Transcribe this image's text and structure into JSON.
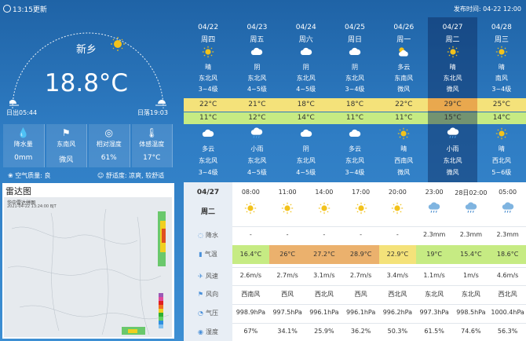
{
  "header": {
    "update_label": "13:15更新",
    "publish_label": "发布时间: 04-22 12:00"
  },
  "current": {
    "city": "新乡",
    "temperature": "18.8°C",
    "sunrise": "日出05:44",
    "sunset": "日落19:03",
    "stats": [
      {
        "label": "降水量",
        "value": "0mm",
        "icon": "raindrop-icon"
      },
      {
        "label": "东南风",
        "value": "微风",
        "icon": "wind-icon"
      },
      {
        "label": "相对湿度",
        "value": "61%",
        "icon": "humidity-icon"
      },
      {
        "label": "体感温度",
        "value": "17°C",
        "icon": "thermometer-icon"
      }
    ],
    "air_quality": "空气质量: 良",
    "comfort": "舒适度: 凉爽, 较舒适"
  },
  "radar": {
    "title": "雷达图",
    "map_title": "华中雷达拼图",
    "map_time": "2021-04-22 13:24:00 BJT"
  },
  "forecast": [
    {
      "date": "04/22",
      "weekday": "周四",
      "day_weather": "晴",
      "day_wind_dir": "东北风",
      "day_wind_lvl": "3~4级",
      "high": "22°C",
      "low": "11°C",
      "night_weather": "多云",
      "night_wind_dir": "东北风",
      "night_wind_lvl": "3~4级",
      "day_icon": "sun",
      "night_icon": "cloud"
    },
    {
      "date": "04/23",
      "weekday": "周五",
      "day_weather": "阴",
      "day_wind_dir": "东北风",
      "day_wind_lvl": "4~5级",
      "high": "21°C",
      "low": "12°C",
      "night_weather": "小雨",
      "night_wind_dir": "东北风",
      "night_wind_lvl": "4~5级",
      "day_icon": "cloud",
      "night_icon": "rain"
    },
    {
      "date": "04/24",
      "weekday": "周六",
      "day_weather": "阴",
      "day_wind_dir": "东北风",
      "day_wind_lvl": "4~5级",
      "high": "18°C",
      "low": "14°C",
      "night_weather": "阴",
      "night_wind_dir": "东北风",
      "night_wind_lvl": "4~5级",
      "day_icon": "cloud",
      "night_icon": "cloud"
    },
    {
      "date": "04/25",
      "weekday": "周日",
      "day_weather": "阴",
      "day_wind_dir": "东北风",
      "day_wind_lvl": "3~4级",
      "high": "18°C",
      "low": "11°C",
      "night_weather": "多云",
      "night_wind_dir": "东北风",
      "night_wind_lvl": "3~4级",
      "day_icon": "cloud",
      "night_icon": "cloud"
    },
    {
      "date": "04/26",
      "weekday": "周一",
      "day_weather": "多云",
      "day_wind_dir": "东南风",
      "day_wind_lvl": "微风",
      "high": "22°C",
      "low": "11°C",
      "night_weather": "晴",
      "night_wind_dir": "西南风",
      "night_wind_lvl": "微风",
      "day_icon": "partly",
      "night_icon": "sun"
    },
    {
      "date": "04/27",
      "weekday": "周二",
      "day_weather": "晴",
      "day_wind_dir": "东北风",
      "day_wind_lvl": "微风",
      "high": "29°C",
      "low": "15°C",
      "night_weather": "小雨",
      "night_wind_dir": "东北风",
      "night_wind_lvl": "微风",
      "day_icon": "sun",
      "night_icon": "rain"
    },
    {
      "date": "04/28",
      "weekday": "周三",
      "day_weather": "晴",
      "day_wind_dir": "南风",
      "day_wind_lvl": "3~4级",
      "high": "25°C",
      "low": "14°C",
      "night_weather": "晴",
      "night_wind_dir": "西北风",
      "night_wind_lvl": "5~6级",
      "day_icon": "sun",
      "night_icon": "sun"
    }
  ],
  "hourly": {
    "date": "04/27",
    "weekday": "周二",
    "row_labels": {
      "precip": "降水",
      "temp": "气温",
      "wind_speed": "风速",
      "wind_dir": "风向",
      "pressure": "气压",
      "humidity": "湿度"
    },
    "times": [
      "08:00",
      "11:00",
      "14:00",
      "17:00",
      "20:00",
      "23:00",
      "28日02:00",
      "05:00"
    ],
    "icons": [
      "sun",
      "sun",
      "sun",
      "sun",
      "sun",
      "rain",
      "rain",
      "rain"
    ],
    "precip": [
      "-",
      "-",
      "-",
      "-",
      "-",
      "2.3mm",
      "2.3mm",
      "2.3mm"
    ],
    "temps": [
      "16.4°C",
      "26°C",
      "27.2°C",
      "28.9°C",
      "22.9°C",
      "19°C",
      "15.4°C",
      "18.6°C"
    ],
    "temp_colors": [
      "#c6eb83",
      "#ebb16d",
      "#ebb16d",
      "#ebb16d",
      "#f4e27a",
      "#c6eb83",
      "#c6eb83",
      "#c6eb83"
    ],
    "wind_speed": [
      "2.6m/s",
      "2.7m/s",
      "3.1m/s",
      "2.7m/s",
      "3.4m/s",
      "1.1m/s",
      "1m/s",
      "4.6m/s"
    ],
    "wind_dir": [
      "西南风",
      "西风",
      "西北风",
      "西风",
      "西北风",
      "东北风",
      "东北风",
      "西北风"
    ],
    "pressure": [
      "998.9hPa",
      "997.5hPa",
      "996.1hPa",
      "996.1hPa",
      "996.2hPa",
      "997.3hPa",
      "998.5hPa",
      "1000.4hPa"
    ],
    "humidity": [
      "67%",
      "34.1%",
      "25.9%",
      "36.2%",
      "50.3%",
      "61.5%",
      "74.6%",
      "56.3%"
    ]
  },
  "colors": {
    "high_band": "#f4e27a",
    "low_band": "#c6eb83",
    "highlight_high": "#e9a84e",
    "sun": "#f2c21c"
  }
}
